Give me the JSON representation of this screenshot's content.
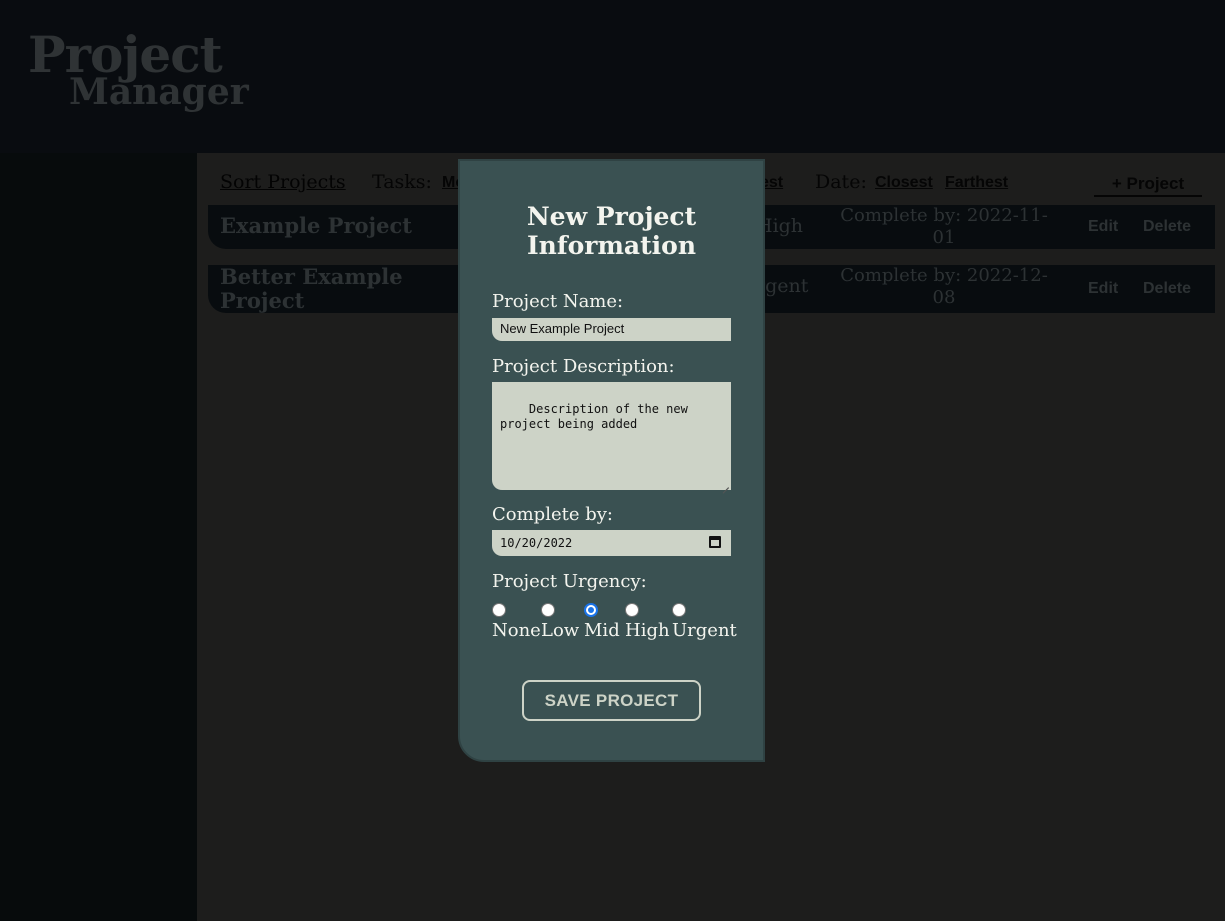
{
  "app": {
    "logo_line1": "Project",
    "logo_line2": "Manager"
  },
  "sortbar": {
    "title": "Sort Projects",
    "tasks_label": "Tasks:",
    "tasks_link_most": "Mo",
    "tasks_link_least": "est",
    "date_label": "Date:",
    "date_closest": "Closest",
    "date_farthest": "Farthest",
    "add_project": "+ Project"
  },
  "projects": [
    {
      "name": "Example Project",
      "urgency": "High",
      "complete_by": "Complete by: 2022-11-01",
      "edit": "Edit",
      "delete": "Delete"
    },
    {
      "name": "Better Example Project",
      "urgency": "rgent",
      "complete_by": "Complete by: 2022-12-08",
      "edit": "Edit",
      "delete": "Delete"
    }
  ],
  "modal": {
    "title": "New Project Information",
    "name_label": "Project Name:",
    "name_value": "New Example Project",
    "desc_label": "Project Description:",
    "desc_value": "Description of the new project being added",
    "date_label": "Complete by:",
    "date_value": "10/20/2022",
    "urgency_label": "Project Urgency:",
    "urgency_options": [
      "None",
      "Low",
      "Mid",
      "High",
      "Urgent"
    ],
    "urgency_selected": "Mid",
    "save_label": "SAVE PROJECT"
  },
  "icons": {
    "date_picker": "calendar-icon"
  },
  "colors": {
    "modal_bg": "#3a5152",
    "input_bg": "#cdd3c7",
    "radio_selected": "#1a73e8"
  }
}
